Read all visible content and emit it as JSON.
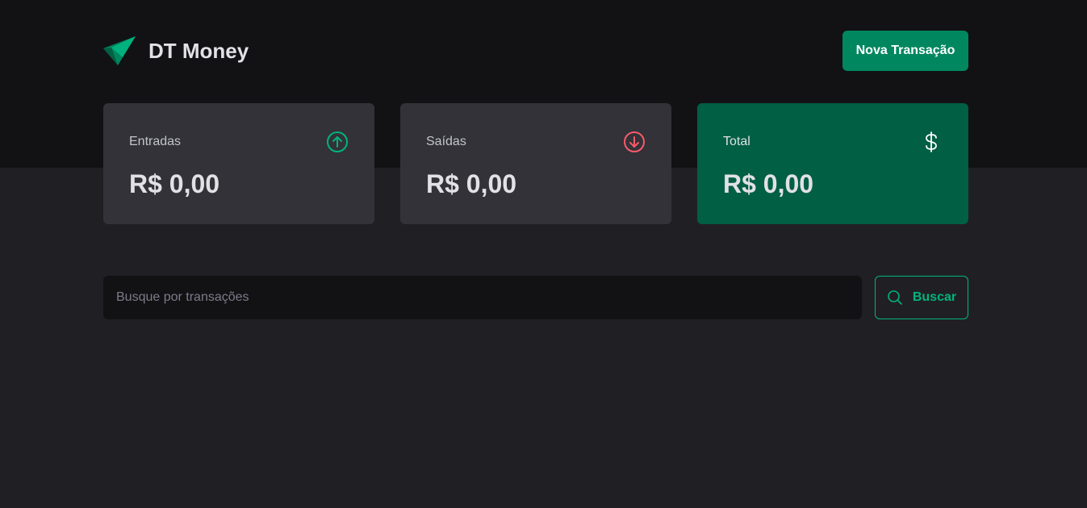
{
  "header": {
    "brand_name": "DT Money",
    "logo_icon": "paper-plane-logo",
    "new_transaction_label": "Nova Transação"
  },
  "summary": {
    "income": {
      "label": "Entradas",
      "value": "R$ 0,00",
      "icon": "arrow-circle-up-icon",
      "icon_color": "#00b37e"
    },
    "outcome": {
      "label": "Saídas",
      "value": "R$ 0,00",
      "icon": "arrow-circle-down-icon",
      "icon_color": "#f75a68"
    },
    "total": {
      "label": "Total",
      "value": "R$ 0,00",
      "icon": "currency-dollar-icon",
      "background": "#015f43"
    }
  },
  "search": {
    "placeholder": "Busque por transações",
    "value": "",
    "button_label": "Buscar"
  },
  "colors": {
    "header_bg": "#121214",
    "page_bg": "#202024",
    "card_bg": "#323238",
    "accent": "#00875f",
    "accent_light": "#00b37e",
    "danger": "#f75a68"
  }
}
